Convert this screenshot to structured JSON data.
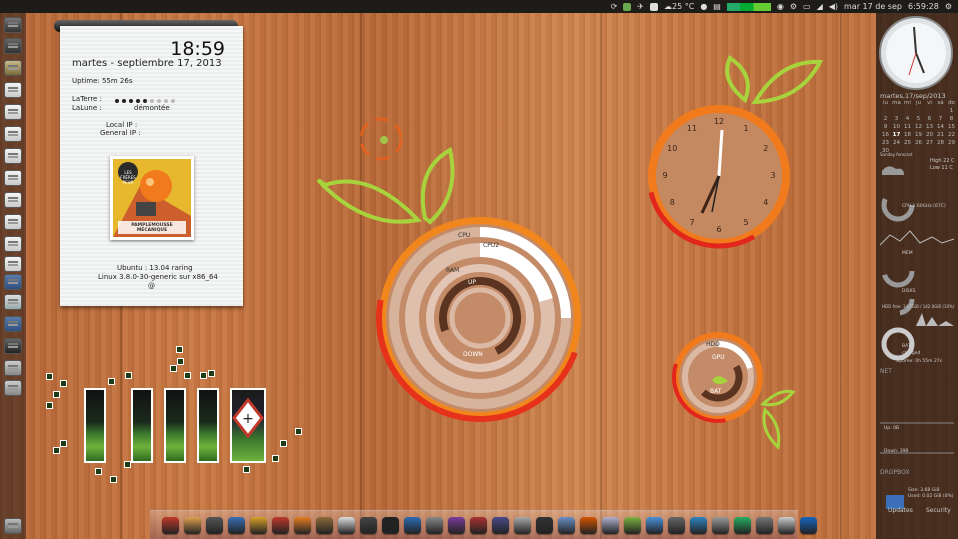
{
  "top_panel": {
    "weather": "25 °C",
    "date": "mar 17 de sep",
    "time": "6:59:28",
    "icons": [
      "refresh-icon",
      "dropbox-icon",
      "mail-icon",
      "document-icon",
      "weather-icon",
      "fruit-icon",
      "equalizer-icon",
      "chart-icon",
      "eye-icon",
      "settings-icon",
      "battery-icon",
      "network-icon",
      "volume-icon",
      "gear-icon"
    ]
  },
  "launcher": {
    "items": [
      "dash-icon",
      "home-folder-icon",
      "files-icon",
      "files-icon",
      "files-icon",
      "files-icon",
      "files-icon",
      "files-icon",
      "files-icon",
      "files-icon",
      "files-icon",
      "files-icon",
      "app-icon",
      "app-icon",
      "workspace-icon",
      "app-icon",
      "app-icon",
      "trash-icon"
    ]
  },
  "note": {
    "time": "18:59",
    "date": "martes - septiembre 17, 2013",
    "uptime": "Uptime: 55m 26s",
    "earth_label": "LaTerre :",
    "moon_label": "LaLune :",
    "moon_value": "démontée",
    "earth_dots_on": 5,
    "earth_dots_total": 9,
    "local_ip": "Local IP :",
    "general_ip": "General IP :",
    "ubuntu": "Ubuntu : 13.04 raring",
    "kernel": "Linux 3.8.0-30-generic sur x86_64",
    "at": "@",
    "album": {
      "top_text": "LES FRÈRES PEUR",
      "bottom_text": "PAMPLEMOUSSE MÉCANIQUE"
    }
  },
  "gauges": {
    "cpu_label": "CPU",
    "cpu2_label": "CPU2",
    "ram_label": "RAM",
    "up_label": "UP",
    "down_label": "DOWN",
    "hdd_label": "HDD",
    "gpu_label": "GPU",
    "bat_label": "BAT"
  },
  "sidebar": {
    "date_header": "martes,17/sep/2013",
    "calendar_header": [
      "lu",
      "ma",
      "mi",
      "ju",
      "vi",
      "sá",
      "do"
    ],
    "calendar_rows": [
      [
        "",
        "",
        "",
        "",
        "",
        "",
        "1"
      ],
      [
        "2",
        "3",
        "4",
        "5",
        "6",
        "7",
        "8"
      ],
      [
        "9",
        "10",
        "11",
        "12",
        "13",
        "14",
        "15"
      ],
      [
        "16",
        "17",
        "18",
        "19",
        "20",
        "21",
        "22"
      ],
      [
        "23",
        "24",
        "25",
        "26",
        "27",
        "28",
        "29"
      ],
      [
        "30",
        "",
        "",
        "",
        "",
        "",
        ""
      ]
    ],
    "weather_title": "Sunday forecast",
    "weather_high": "High 22 C",
    "weather_low": "Low 11 C",
    "cpu_text": "CPU 1.60GHz [67C]",
    "mem_text": "MEM",
    "disks_text": "DISKS",
    "hdd_free": "HDD free: 14.7GiB / 142.0GiB (10%)",
    "bat_text": "BAT",
    "bat_state": "charged",
    "uptime": "Uptime: 0h 55m 27s",
    "net_title": "NET",
    "up": "Up: 0B",
    "down": "Down: 39B",
    "dropbox_title": "DROPBOX",
    "size": "Size: 3.68 GiB",
    "used": "Used: 0.02 GiB (0%)",
    "updates": "Updates",
    "security": "Security"
  },
  "dock": {
    "items": [
      "app-icon",
      "grid-icon",
      "monitor-icon",
      "box-icon",
      "plugin-icon",
      "opera-icon",
      "firefox-icon",
      "editor-icon",
      "cloud-icon",
      "chat-icon",
      "terminal-icon",
      "swirl-icon",
      "bottle-icon",
      "pidgin-icon",
      "alien-icon",
      "hardware-icon",
      "game-icon",
      "webcam-icon",
      "settings-icon",
      "folder-icon",
      "paint-icon",
      "android-icon",
      "search-icon",
      "film-icon",
      "screen-icon",
      "network-icon",
      "star-icon",
      "gear-icon",
      "disc-icon",
      "power-icon"
    ]
  },
  "colors": {
    "panel": "#1e1c19",
    "orange": "#f26a1b",
    "leaf": "#9fd23c"
  }
}
